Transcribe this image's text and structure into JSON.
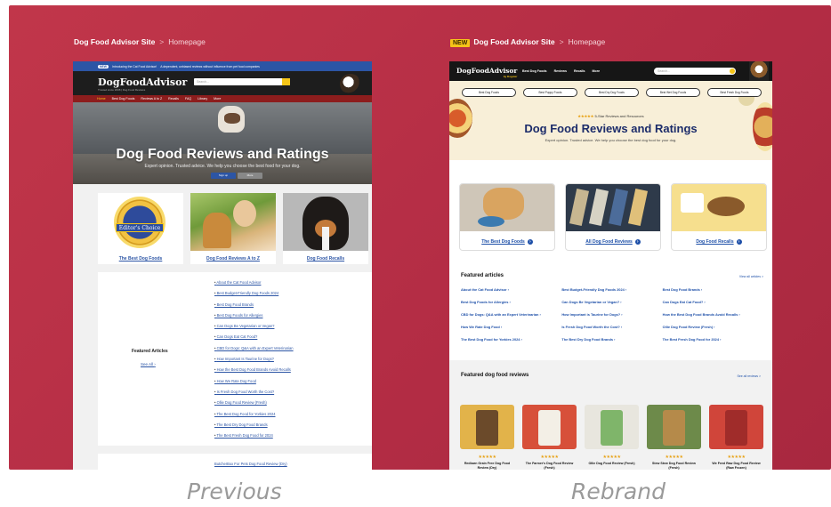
{
  "left": {
    "breadcrumb": {
      "site": "Dog Food Advisor Site",
      "sep": ">",
      "page": "Homepage"
    },
    "caption": "Previous",
    "topbar": {
      "badge": "NEW",
      "text": "Introducing the Cat Food Advisor!",
      "text2": "A dependent, unbiased reviews without influence from pet food companies"
    },
    "logo": "DogFoodAdvisor",
    "logo_tag": "Trusted since 2008 | Dog Food Reviews",
    "search_placeholder": "Search...",
    "nav": [
      "Home",
      "Best Dog Foods",
      "Reviews A to Z",
      "Recalls",
      "FAQ",
      "Library",
      "More"
    ],
    "hero": {
      "title": "Dog Food Reviews and Ratings",
      "subtitle": "Expert opinion. Trusted advice. We help you choose the best food for your dog.",
      "cta1": "Sign up",
      "cta2": "More"
    },
    "cards": [
      {
        "label": "The Best Dog Foods",
        "seal": "Editor's Choice"
      },
      {
        "label": "Dog Food Reviews A to Z"
      },
      {
        "label": "Dog Food Recalls"
      }
    ],
    "featured": {
      "title": "Featured Articles",
      "see_all": "See All",
      "items": [
        "About the Cat Food Advisor",
        "Best Budget-Friendly Dog Foods 2024",
        "Best Dog Food Brands",
        "Best Dog Foods for Allergies",
        "Can Dogs Be Vegetarian or Vegan?",
        "Can Dogs Eat Cat Food?",
        "CBD for Dogs: Q&A with an Expert Veterinarian",
        "How Important Is Taurine for Dogs?",
        "How the Best Dog Food Brands Avoid Recalls",
        "How We Rate Dog Food",
        "Is Fresh Dog Food Worth the Cost?",
        "Ollie Dog Food Review (Fresh)",
        "The Best Dog Food for Yorkies 2024",
        "The Best Dry Dog Food Brands",
        "The Best Fresh Dog Food for 2024"
      ],
      "next_item": "ButcherBox For Pets Dog Food Review (Dry)"
    }
  },
  "right": {
    "breadcrumb": {
      "badge": "NEW",
      "site": "Dog Food Advisor Site",
      "sep": ">",
      "page": "Homepage"
    },
    "caption": "Rebrand",
    "logo": "DogFoodAdvisor",
    "logo_tag": "by Dogster",
    "menu": [
      "Best Dog Foods",
      "Reviews",
      "Recalls",
      "More"
    ],
    "search_placeholder": "Search...",
    "pills": [
      "Best Dog Foods",
      "Best Puppy Foods",
      "Best Dry Dog Foods",
      "Best Wet Dog Foods",
      "Best Fresh Dog Foods"
    ],
    "stars_text": "5-Star Reviews and Resources",
    "hero": {
      "title": "Dog Food Reviews and Ratings",
      "subtitle": "Expert opinion. Trusted advice. We help you choose the best dog food for your dog."
    },
    "cards": [
      "The Best Dog Foods",
      "All Dog Food Reviews",
      "Dog Food Recalls"
    ],
    "featured": {
      "title": "Featured articles",
      "view_all": "View all articles >",
      "col1": [
        "About the Cat Food Advisor",
        "Best Dog Foods for Allergies",
        "CBD for Dogs: Q&A with an Expert Veterinarian",
        "How We Rate Dog Food",
        "The Best Dog Food for Yorkies 2024"
      ],
      "col2": [
        "Best Budget-Friendly Dog Foods 2024",
        "Can Dogs Be Vegetarian or Vegan?",
        "How Important is Taurine for Dogs?",
        "Is Fresh Dog Food Worth the Cost?",
        "The Best Dry Dog Food Brands"
      ],
      "col3": [
        "Best Dog Food Brands",
        "Can Dogs Eat Cat Food?",
        "How the Best Dog Food Brands Avoid Recalls",
        "Ollie Dog Food Review (Fresh)",
        "The Best Fresh Dog Food for 2024"
      ]
    },
    "reviews": {
      "title": "Featured dog food reviews",
      "view_all": "See all reviews >",
      "stars": "★★★★★",
      "items": [
        {
          "name": "Redbarn Grain Free Dog Food Review (Dry)",
          "bg": "#e2b34a",
          "bag": "#6b4a2a"
        },
        {
          "name": "The Farmer's Dog Food Review (Fresh)",
          "bg": "#d7503a",
          "bag": "#f3efe6"
        },
        {
          "name": "Ollie Dog Food Review (Fresh)",
          "bg": "#e8e6de",
          "bag": "#7fb56a"
        },
        {
          "name": "Stew Stew Dog Food Review (Fresh)",
          "bg": "#6d8a4a",
          "bag": "#b58a4a"
        },
        {
          "name": "We Feed Raw Dog Food Review (Raw Frozen)",
          "bg": "#d0453a",
          "bag": "#a02c2a"
        }
      ]
    }
  }
}
